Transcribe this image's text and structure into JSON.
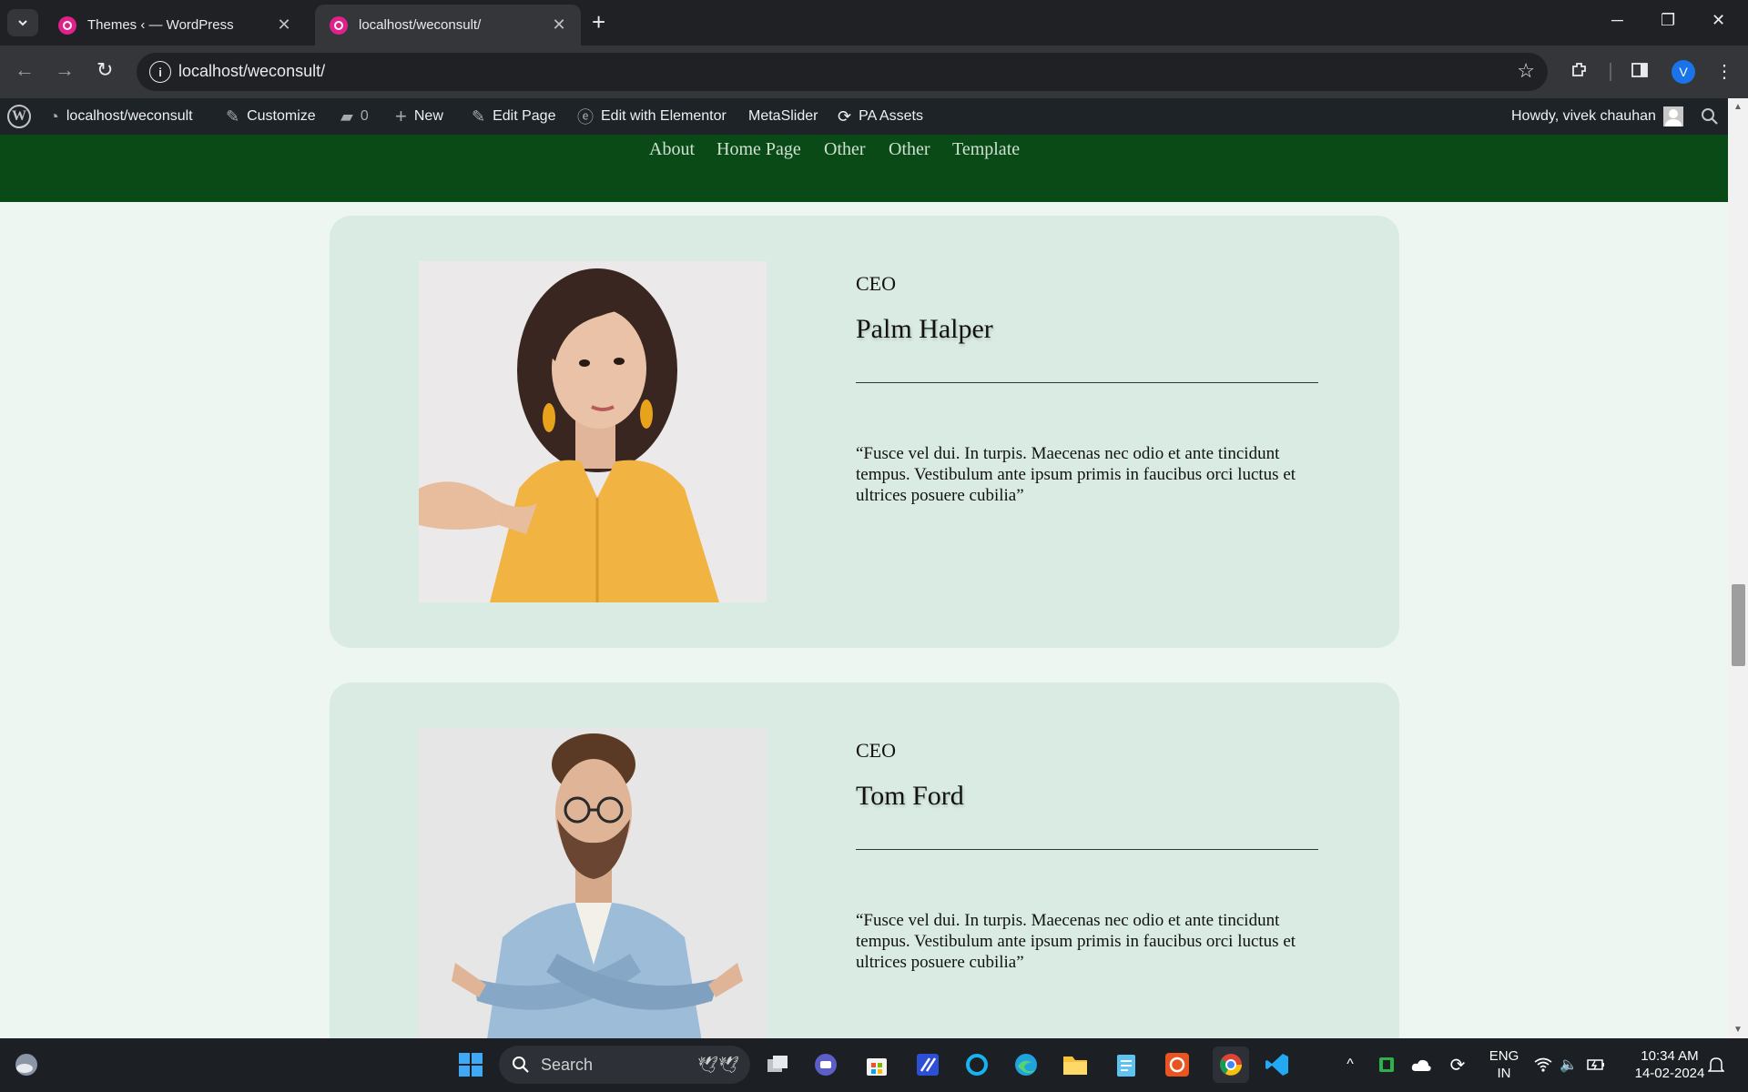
{
  "browser": {
    "tabs": [
      {
        "title": "Themes ‹ — WordPress",
        "active": false
      },
      {
        "title": "localhost/weconsult/",
        "active": true
      }
    ],
    "url": "localhost/weconsult/",
    "profile_initial": "V"
  },
  "admin_bar": {
    "site": "localhost/weconsult",
    "customize": "Customize",
    "comments_count": "0",
    "new": "New",
    "edit_page": "Edit Page",
    "edit_elementor": "Edit with Elementor",
    "metaslider": "MetaSlider",
    "pa_assets": "PA Assets",
    "howdy": "Howdy, vivek chauhan"
  },
  "site_nav": [
    "About",
    "Home Page",
    "Other",
    "Other",
    "Template"
  ],
  "team": [
    {
      "role": "CEO",
      "name": "Palm Halper",
      "quote": "“Fusce vel dui. In turpis. Maecenas nec odio et ante tincidunt tempus. Vestibulum ante ipsum primis in faucibus orci luctus et ultrices posuere cubilia”"
    },
    {
      "role": "CEO",
      "name": "Tom Ford",
      "quote": "“Fusce vel dui. In turpis. Maecenas nec odio et ante tincidunt tempus. Vestibulum ante ipsum primis in faucibus orci luctus et ultrices posuere cubilia”"
    }
  ],
  "taskbar": {
    "search_label": "Search",
    "lang_top": "ENG",
    "lang_bottom": "IN",
    "time": "10:34 AM",
    "date": "14-02-2024"
  },
  "colors": {
    "site_header": "#0a4a17",
    "card_bg": "#d9ebe2",
    "page_bg": "#eef6f1",
    "wp_bar": "#1d2327",
    "favicon": "#e0218a"
  }
}
